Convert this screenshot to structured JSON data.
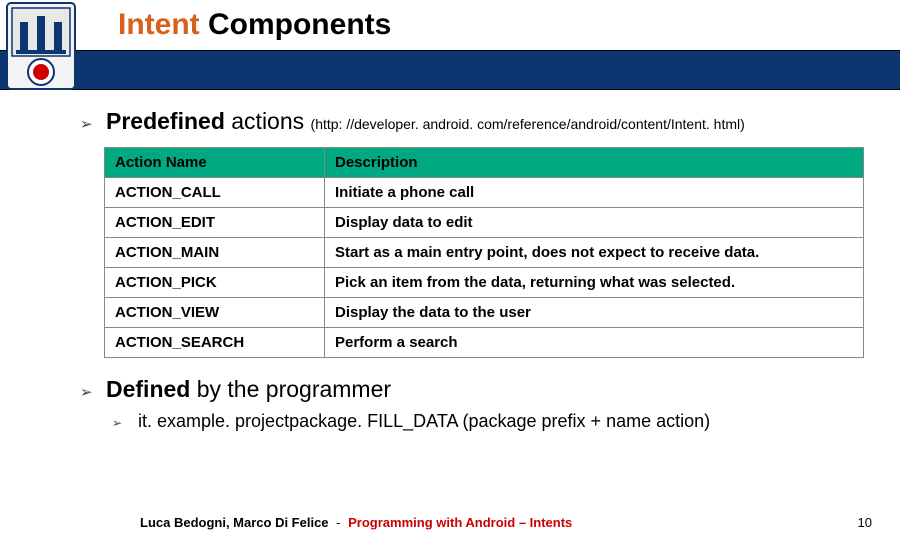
{
  "title": {
    "part1": "Intent",
    "part2": " Components"
  },
  "section1": {
    "heading_bold": "Predefined",
    "heading_rest": " actions ",
    "url": "(http: //developer. android. com/reference/android/content/Intent. html)"
  },
  "table": {
    "header": {
      "col1": "Action Name",
      "col2": "Description"
    },
    "rows": [
      {
        "name": "ACTION_CALL",
        "desc": "Initiate a phone call"
      },
      {
        "name": "ACTION_EDIT",
        "desc": "Display data to edit"
      },
      {
        "name": "ACTION_MAIN",
        "desc": "Start as a main entry point, does not expect to receive data."
      },
      {
        "name": "ACTION_PICK",
        "desc": "Pick an item from the data, returning what was selected."
      },
      {
        "name": "ACTION_VIEW",
        "desc": "Display the data to the user"
      },
      {
        "name": "ACTION_SEARCH",
        "desc": "Perform a search"
      }
    ]
  },
  "section2": {
    "heading_bold": "Defined",
    "heading_rest": " by the programmer",
    "sub": "it. example. projectpackage. FILL_DATA (package prefix + name action)"
  },
  "footer": {
    "authors": "Luca Bedogni, Marco Di Felice",
    "sep": "-",
    "lecture": "Programming with Android – Intents",
    "page": "10"
  }
}
